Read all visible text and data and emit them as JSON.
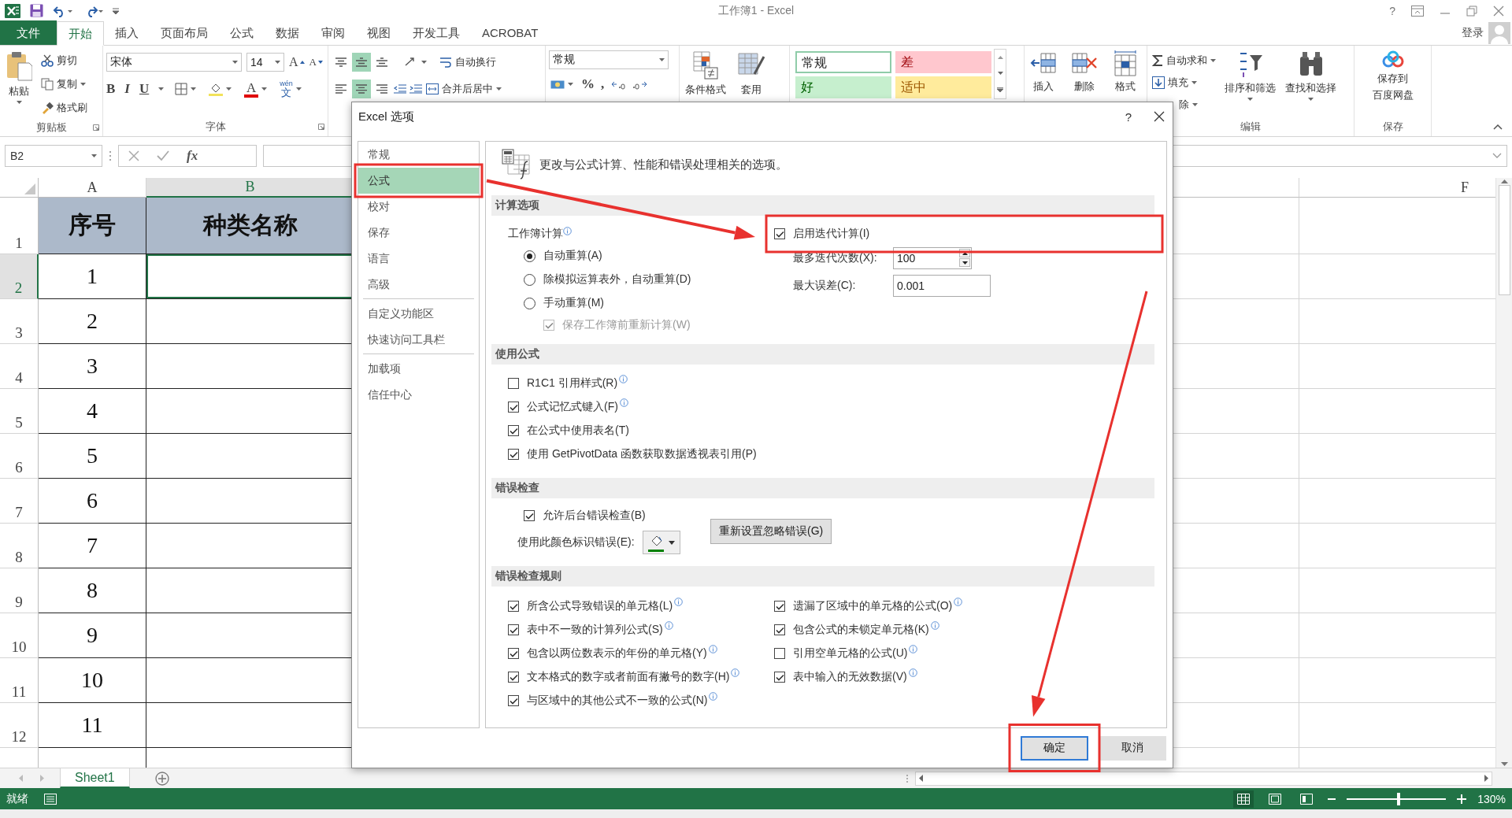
{
  "window": {
    "title": "工作簿1 - Excel",
    "help": "?",
    "account": "登录"
  },
  "ribbon_tabs": [
    {
      "label": "文件",
      "kind": "file",
      "selected": false
    },
    {
      "label": "开始",
      "kind": "tab",
      "selected": true
    },
    {
      "label": "插入",
      "kind": "tab",
      "selected": false
    },
    {
      "label": "页面布局",
      "kind": "tab",
      "selected": false
    },
    {
      "label": "公式",
      "kind": "tab",
      "selected": false
    },
    {
      "label": "数据",
      "kind": "tab",
      "selected": false
    },
    {
      "label": "审阅",
      "kind": "tab",
      "selected": false
    },
    {
      "label": "视图",
      "kind": "tab",
      "selected": false
    },
    {
      "label": "开发工具",
      "kind": "tab",
      "selected": false
    },
    {
      "label": "ACROBAT",
      "kind": "tab",
      "selected": false
    }
  ],
  "ribbon": {
    "clipboard": {
      "paste": "粘贴",
      "cut": "剪切",
      "copy": "复制",
      "format_painter": "格式刷",
      "label": "剪贴板"
    },
    "font": {
      "font_name": "宋体",
      "font_size": "14",
      "grow": "A",
      "shrink": "A",
      "bold": "B",
      "italic": "I",
      "underline": "U",
      "font_color": "A",
      "phonetic_top": "wén",
      "phonetic": "文",
      "label": "字体"
    },
    "alignment": {
      "wrap_text": "自动换行",
      "merge_center": "合并后居中",
      "vertical": [
        {
          "kind": "top",
          "selected": false
        },
        {
          "kind": "middle",
          "selected": true
        },
        {
          "kind": "bottom",
          "selected": false
        }
      ],
      "horizontal": [
        {
          "kind": "left",
          "selected": false
        },
        {
          "kind": "center",
          "selected": true
        },
        {
          "kind": "right",
          "selected": false
        }
      ]
    },
    "number": {
      "format": "常规",
      "percent": "%",
      "comma": ","
    },
    "conditional_format": "条件格式",
    "table_format": "套用",
    "cell_styles": [
      {
        "label": "常规",
        "kind": "normal",
        "selected": true
      },
      {
        "label": "差",
        "kind": "bad",
        "selected": false
      },
      {
        "label": "好",
        "kind": "good",
        "selected": false
      },
      {
        "label": "适中",
        "kind": "neutral",
        "selected": false
      }
    ],
    "cells": [
      {
        "label": "插入",
        "kind": "insert"
      },
      {
        "label": "删除",
        "kind": "delete"
      },
      {
        "label": "格式",
        "kind": "format"
      }
    ],
    "editing": {
      "autosum": "自动求和",
      "fill": "填充",
      "clear": "除",
      "sort_filter": "排序和筛选",
      "find_select": "查找和选择",
      "label": "编辑"
    },
    "save": {
      "button": [
        "保存到",
        "百度网盘"
      ],
      "label": "保存"
    }
  },
  "formula_bar": {
    "name_box": "B2",
    "fx": "fx"
  },
  "sheet": {
    "columns": [
      {
        "label": "A",
        "kind": "data",
        "selected": false
      },
      {
        "label": "B",
        "kind": "data",
        "selected": true
      },
      {
        "label": "F",
        "kind": "outside",
        "selected": false
      }
    ],
    "rows": [
      {
        "header": "1",
        "kind": "heading",
        "selected": false,
        "cells": [
          "序号",
          "种类名称"
        ]
      },
      {
        "header": "2",
        "kind": "data",
        "selected": true,
        "cells": [
          "1"
        ]
      },
      {
        "header": "3",
        "kind": "data",
        "selected": false,
        "cells": [
          "2"
        ]
      },
      {
        "header": "4",
        "kind": "data",
        "selected": false,
        "cells": [
          "3"
        ]
      },
      {
        "header": "5",
        "kind": "data",
        "selected": false,
        "cells": [
          "4"
        ]
      },
      {
        "header": "6",
        "kind": "data",
        "selected": false,
        "cells": [
          "5"
        ]
      },
      {
        "header": "7",
        "kind": "data",
        "selected": false,
        "cells": [
          "6"
        ]
      },
      {
        "header": "8",
        "kind": "data",
        "selected": false,
        "cells": [
          "7"
        ]
      },
      {
        "header": "9",
        "kind": "data",
        "selected": false,
        "cells": [
          "8"
        ]
      },
      {
        "header": "10",
        "kind": "data",
        "selected": false,
        "cells": [
          "9"
        ]
      },
      {
        "header": "11",
        "kind": "data",
        "selected": false,
        "cells": [
          "10"
        ]
      },
      {
        "header": "12",
        "kind": "data",
        "selected": false,
        "cells": [
          "11"
        ]
      }
    ]
  },
  "sheet_tabs": [
    {
      "label": "Sheet1",
      "selected": true
    }
  ],
  "status_bar": {
    "text": "就绪",
    "zoom": {
      "level": 0.52,
      "reading": "130%"
    }
  },
  "dialog": {
    "title": "Excel 选项",
    "help": "?",
    "nav_groups": [
      [
        {
          "label": "常规",
          "selected": false,
          "highlighted": false
        },
        {
          "label": "公式",
          "selected": true,
          "highlighted": true
        },
        {
          "label": "校对",
          "selected": false,
          "highlighted": false
        },
        {
          "label": "保存",
          "selected": false,
          "highlighted": false
        },
        {
          "label": "语言",
          "selected": false,
          "highlighted": false
        },
        {
          "label": "高级",
          "selected": false,
          "highlighted": false
        }
      ],
      [
        {
          "label": "自定义功能区",
          "selected": false,
          "highlighted": false
        },
        {
          "label": "快速访问工具栏",
          "selected": false,
          "highlighted": false
        }
      ],
      [
        {
          "label": "加载项",
          "selected": false,
          "highlighted": false
        },
        {
          "label": "信任中心",
          "selected": false,
          "highlighted": false
        }
      ]
    ],
    "intro": "更改与公式计算、性能和错误处理相关的选项。",
    "calculation": {
      "title": "计算选项",
      "workbook_label": "工作簿计算",
      "modes": [
        {
          "label": "自动重算(A)",
          "selected": true
        },
        {
          "label": "除模拟运算表外，自动重算(D)",
          "selected": false
        },
        {
          "label": "手动重算(M)",
          "selected": false
        }
      ],
      "recalc_before_save": {
        "label": "保存工作簿前重新计算(W)",
        "checked": true,
        "disabled": true
      },
      "iterative": {
        "label": "启用迭代计算(I)",
        "checked": true,
        "highlighted": true
      },
      "max_iterations": {
        "label": "最多迭代次数(X):",
        "value": "100"
      },
      "max_change": {
        "label": "最大误差(C):",
        "value": "0.001"
      }
    },
    "formulas": {
      "title": "使用公式",
      "options": [
        {
          "label": "R1C1 引用样式(R)",
          "checked": false,
          "info": true
        },
        {
          "label": "公式记忆式键入(F)",
          "checked": true,
          "info": true
        },
        {
          "label": "在公式中使用表名(T)",
          "checked": true,
          "info": false
        },
        {
          "label": "使用 GetPivotData 函数获取数据透视表引用(P)",
          "checked": true,
          "info": false
        }
      ]
    },
    "error_checking": {
      "title": "错误检查",
      "background": {
        "label": "允许后台错误检查(B)",
        "checked": true
      },
      "color_label": "使用此颜色标识错误(E):",
      "color": "#008000",
      "reset_button": "重新设置忽略错误(G)"
    },
    "rules": {
      "title": "错误检查规则",
      "columns": [
        [
          {
            "label": "所含公式导致错误的单元格(L)",
            "checked": true,
            "info": true
          },
          {
            "label": "表中不一致的计算列公式(S)",
            "checked": true,
            "info": true
          },
          {
            "label": "包含以两位数表示的年份的单元格(Y)",
            "checked": true,
            "info": true
          },
          {
            "label": "文本格式的数字或者前面有撇号的数字(H)",
            "checked": true,
            "info": true
          },
          {
            "label": "与区域中的其他公式不一致的公式(N)",
            "checked": true,
            "info": true
          }
        ],
        [
          {
            "label": "遗漏了区域中的单元格的公式(O)",
            "checked": true,
            "info": true
          },
          {
            "label": "包含公式的未锁定单元格(K)",
            "checked": true,
            "info": true
          },
          {
            "label": "引用空单元格的公式(U)",
            "checked": false,
            "info": true
          },
          {
            "label": "表中输入的无效数据(V)",
            "checked": true,
            "info": true
          }
        ]
      ]
    },
    "buttons": [
      {
        "label": "确定",
        "kind": "default",
        "highlighted": true
      },
      {
        "label": "取消",
        "kind": "normal",
        "highlighted": false
      }
    ]
  }
}
